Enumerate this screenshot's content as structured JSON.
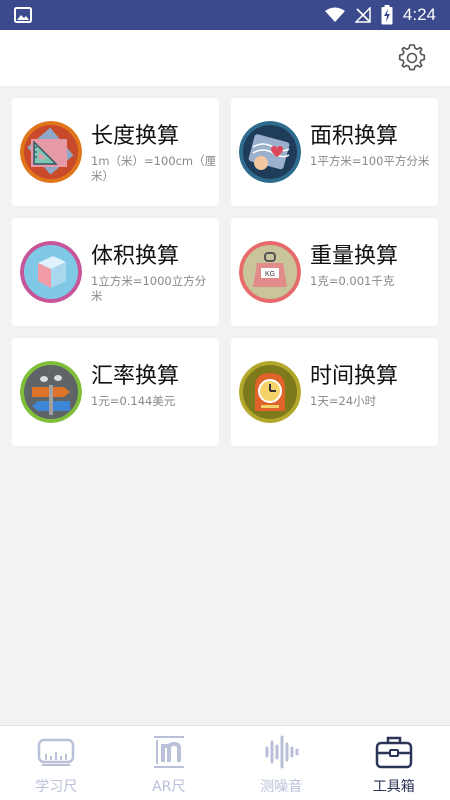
{
  "status_bar": {
    "time": "4:24",
    "icons": [
      "image-icon",
      "wifi-icon",
      "no-signal-icon",
      "battery-charging-icon"
    ]
  },
  "header": {
    "settings_icon": "gear-icon"
  },
  "cards": [
    {
      "title": "长度换算",
      "desc": "1m（米）=100cm（厘米）",
      "icon": "ruler-icon"
    },
    {
      "title": "面积换算",
      "desc": "1平方米=100平方分米",
      "icon": "area-map-icon"
    },
    {
      "title": "体积换算",
      "desc": "1立方米=1000立方分米",
      "icon": "cube-icon"
    },
    {
      "title": "重量换算",
      "desc": "1克=0.001千克",
      "icon": "weight-icon"
    },
    {
      "title": "汇率换算",
      "desc": "1元=0.144美元",
      "icon": "exchange-icon"
    },
    {
      "title": "时间换算",
      "desc": "1天=24小时",
      "icon": "clock-icon"
    }
  ],
  "bottom_nav": [
    {
      "label": "学习尺",
      "icon": "ruler-tab-icon",
      "active": false
    },
    {
      "label": "AR尺",
      "icon": "ar-ruler-icon",
      "active": false
    },
    {
      "label": "测噪音",
      "icon": "sound-wave-icon",
      "active": false
    },
    {
      "label": "工具箱",
      "icon": "toolbox-icon",
      "active": true
    }
  ],
  "colors": {
    "status_bar": "#3a4a8c",
    "active_tab": "#2b3558",
    "inactive_tab": "#b9c0d8"
  }
}
